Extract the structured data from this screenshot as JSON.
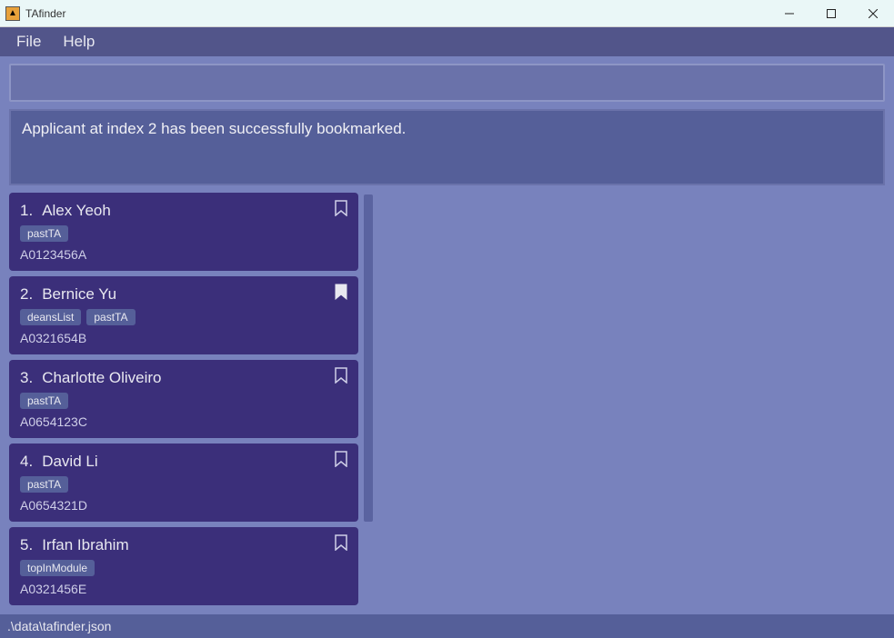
{
  "window": {
    "title": "TAfinder"
  },
  "menubar": {
    "items": [
      "File",
      "Help"
    ]
  },
  "command_input": {
    "value": "",
    "placeholder": ""
  },
  "result": {
    "message": "Applicant at index 2 has been successfully bookmarked."
  },
  "applicants": [
    {
      "index": "1.",
      "name": "Alex Yeoh",
      "tags": [
        "pastTA"
      ],
      "id": "A0123456A",
      "bookmarked": false
    },
    {
      "index": "2.",
      "name": "Bernice Yu",
      "tags": [
        "deansList",
        "pastTA"
      ],
      "id": "A0321654B",
      "bookmarked": true
    },
    {
      "index": "3.",
      "name": "Charlotte Oliveiro",
      "tags": [
        "pastTA"
      ],
      "id": "A0654123C",
      "bookmarked": false
    },
    {
      "index": "4.",
      "name": "David Li",
      "tags": [
        "pastTA"
      ],
      "id": "A0654321D",
      "bookmarked": false
    },
    {
      "index": "5.",
      "name": "Irfan Ibrahim",
      "tags": [
        "topInModule"
      ],
      "id": "A0321456E",
      "bookmarked": false
    }
  ],
  "statusbar": {
    "path": ".\\data\\tafinder.json"
  }
}
